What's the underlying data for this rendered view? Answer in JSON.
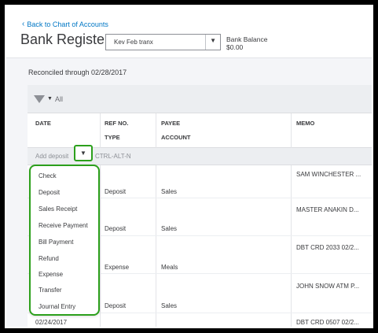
{
  "header": {
    "back_link": "Back to Chart of Accounts",
    "title": "Bank Register",
    "account_selected": "Kev Feb tranx",
    "bank_balance_label": "Bank Balance",
    "bank_balance_value": "$0.00"
  },
  "reconciled": "Reconciled through 02/28/2017",
  "filter": {
    "label": "All"
  },
  "columns": {
    "date": "DATE",
    "ref_no": "REF NO.",
    "type": "TYPE",
    "payee": "PAYEE",
    "account": "ACCOUNT",
    "memo": "MEMO"
  },
  "add_row": {
    "label": "Add deposit",
    "shortcut": "CTRL-ALT-N"
  },
  "dropdown_items": [
    "Check",
    "Deposit",
    "Sales Receipt",
    "Receive Payment",
    "Bill Payment",
    "Refund",
    "Expense",
    "Transfer",
    "Journal Entry"
  ],
  "rows": [
    {
      "memo": "SAM WINCHESTER ...",
      "type": "Deposit",
      "account": "Sales"
    },
    {
      "memo": "MASTER ANAKIN D...",
      "type": "Deposit",
      "account": "Sales"
    },
    {
      "memo": "DBT CRD 2033 02/2...",
      "type": "Expense",
      "account": "Meals"
    },
    {
      "memo": "JOHN SNOW ATM P...",
      "type": "Deposit",
      "account": "Sales"
    },
    {
      "date": "02/24/2017",
      "memo": "DBT CRD 0507 02/2..."
    }
  ],
  "colors": {
    "accent_green": "#2ca01c",
    "link_blue": "#0077c5"
  }
}
